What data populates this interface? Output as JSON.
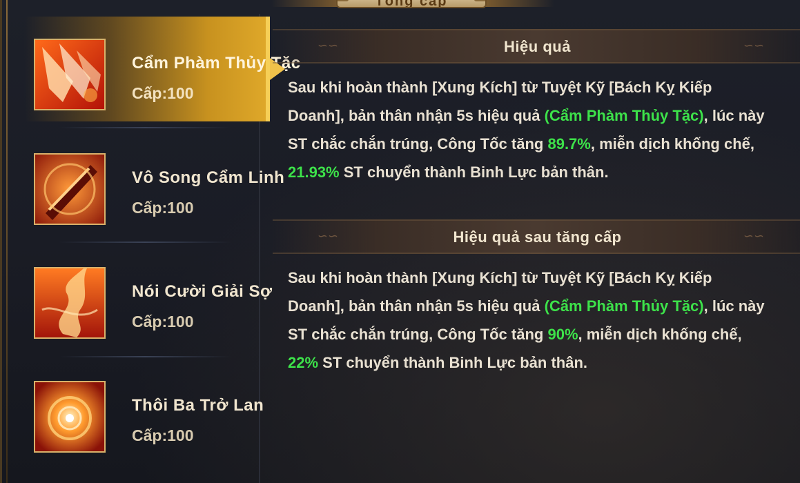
{
  "panel": {
    "title": "Tổng cấp"
  },
  "skills": [
    {
      "name": "Cẩm Phàm Thủy Tặc",
      "level": "Cấp:100",
      "icon": "claw-slash-icon"
    },
    {
      "name": "Vô Song Cẩm Linh",
      "level": "Cấp:100",
      "icon": "blade-fire-icon"
    },
    {
      "name": "Nói Cười Giải Sợ",
      "level": "Cấp:100",
      "icon": "flame-swirl-icon"
    },
    {
      "name": "Thôi Ba Trở Lan",
      "level": "Cấp:100",
      "icon": "fire-vortex-icon"
    }
  ],
  "effect": {
    "title": "Hiệu quả",
    "parts": [
      "Sau khi hoàn thành [Xung Kích] từ Tuyệt Kỹ [Bách Kỵ Kiếp Doanh], bản thân nhận 5s hiệu quả ",
      "(Cẩm Phàm Thủy Tặc)",
      ", lúc này ST chắc chắn trúng, Công Tốc tăng ",
      "89.7%",
      ", miễn dịch khống chế, ",
      "21.93%",
      " ST chuyển thành Binh Lực bản thân."
    ]
  },
  "upgrade": {
    "title": "Hiệu quả sau tăng cấp",
    "parts": [
      "Sau khi hoàn thành [Xung Kích] từ Tuyệt Kỹ [Bách Kỵ Kiếp Doanh], bản thân nhận 5s hiệu quả ",
      "(Cẩm Phàm Thủy Tặc)",
      ", lúc này ST chắc chắn trúng, Công Tốc tăng ",
      "90%",
      ", miễn dịch khống chế, ",
      "22%",
      " ST chuyển thành Binh Lực bản thân."
    ]
  },
  "colors": {
    "highlight": "#3de24a",
    "active_tab": "#e0a92a",
    "text": "#e9e1d2"
  }
}
